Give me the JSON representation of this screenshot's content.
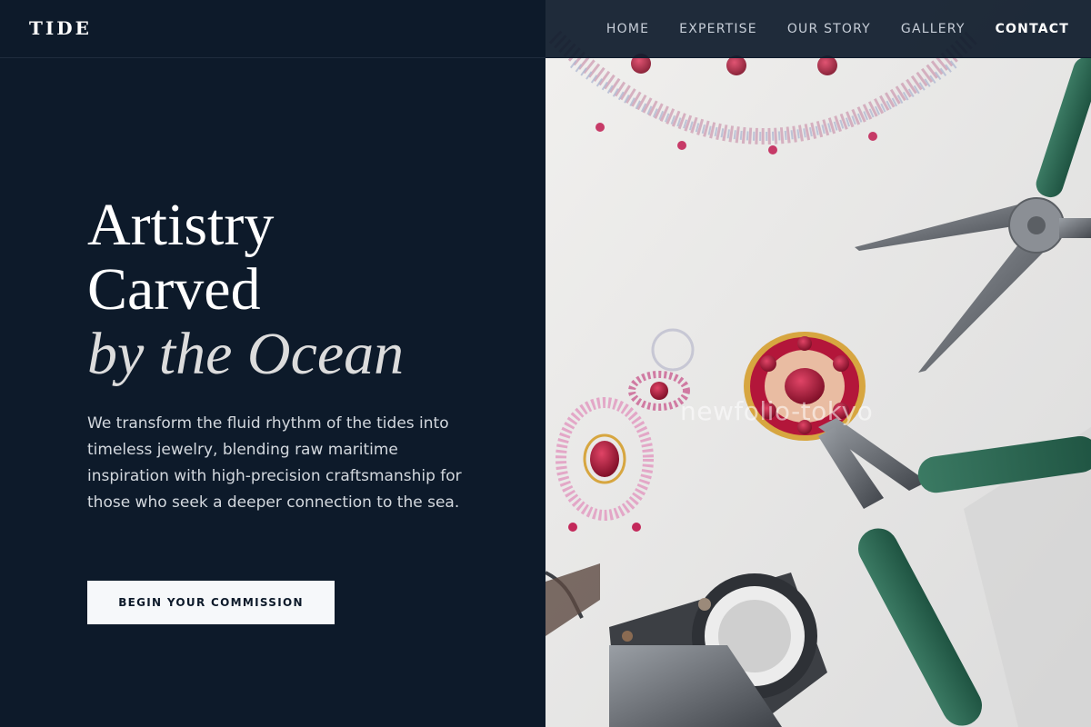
{
  "brand": {
    "logo": "TIDE"
  },
  "nav": {
    "items": [
      {
        "label": "HOME"
      },
      {
        "label": "EXPERTISE"
      },
      {
        "label": "OUR STORY"
      },
      {
        "label": "GALLERY"
      },
      {
        "label": "CONTACT"
      }
    ],
    "active": "CONTACT"
  },
  "hero": {
    "headline_line1": "Artistry",
    "headline_line2": "Carved",
    "headline_line3": "by the Ocean",
    "intro": "We transform the fluid rhythm of the tides into timeless jewelry, blending raw maritime inspiration with high-precision craftsmanship for those who seek a deeper connection to the sea.",
    "cta_label": "BEGIN YOUR COMMISSION",
    "image_watermark": "newfolio-tokyo",
    "image_subject": "jewelry-workbench-photo"
  },
  "colors": {
    "background": "#0d1a2a",
    "cta_background": "#f6f8fa",
    "plier_handle": "#2f6b55",
    "ruby": "#b3163a",
    "gold": "#d7a640"
  }
}
